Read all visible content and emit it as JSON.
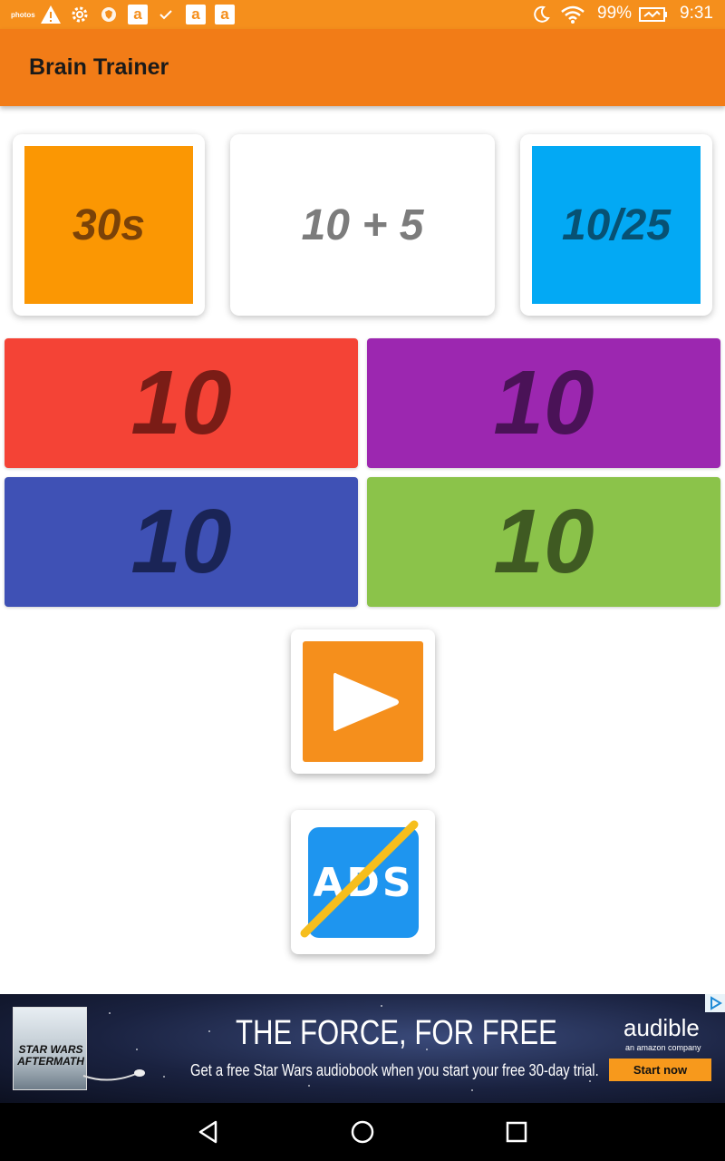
{
  "status_bar": {
    "battery": "99%",
    "time": "9:31",
    "notif_photos": "photos"
  },
  "app": {
    "title": "Brain Trainer"
  },
  "game": {
    "timer": "30s",
    "question": "10 + 5",
    "score": "10/25",
    "answers": [
      {
        "value": "10",
        "bg": "#f44336",
        "fg": "#7a1c16"
      },
      {
        "value": "10",
        "bg": "#9c27b0",
        "fg": "#4a1257"
      },
      {
        "value": "10",
        "bg": "#3f51b5",
        "fg": "#1a2456"
      },
      {
        "value": "10",
        "bg": "#8bc34a",
        "fg": "#3f5a22"
      }
    ]
  },
  "buttons": {
    "play_icon": "play-icon",
    "ads_label": "ADS"
  },
  "ad": {
    "book_title": "STAR WARS AFTERMATH",
    "headline": "THE FORCE, FOR FREE",
    "subline": "Get a free Star Wars audiobook when you start your free 30-day trial.",
    "brand": "audible",
    "brand_sub": "an amazon company",
    "cta": "Start now"
  },
  "colors": {
    "primary": "#f27c17",
    "status": "#f58f1c"
  }
}
